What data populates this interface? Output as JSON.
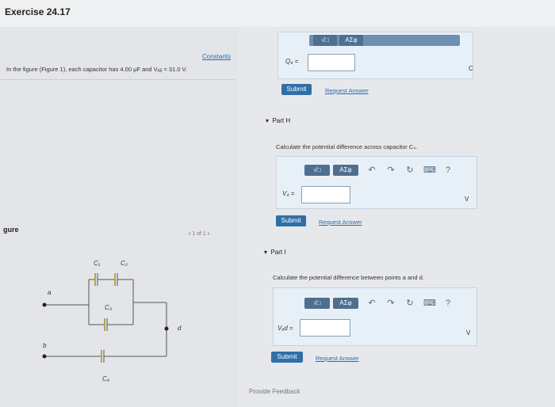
{
  "header": {
    "title": "Exercise 24.17"
  },
  "problem": {
    "constants_link": "Constants",
    "statement": "In the figure (Figure 1), each capacitor has 4.00 μF and Vₐᵦ = 31.0 V."
  },
  "figure": {
    "label": "gure",
    "pager": "1 of 1",
    "c1": "C₁",
    "c2": "C₂",
    "c3": "C₃",
    "c4": "C₄",
    "a": "a",
    "b": "b",
    "d": "d"
  },
  "part_g": {
    "field_label": "Q₄ =",
    "unit": "C",
    "submit": "Submit",
    "request": "Request Answer"
  },
  "part_h": {
    "title": "Part H",
    "question": "Calculate the potential difference across capacitor C₄.",
    "field_label": "V₄ =",
    "unit": "V",
    "submit": "Submit",
    "request": "Request Answer"
  },
  "part_i": {
    "title": "Part I",
    "question": "Calculate the potential difference between points a and d.",
    "field_label": "Vₐd =",
    "unit": "V",
    "submit": "Submit",
    "request": "Request Answer"
  },
  "toolbar": {
    "templates": "√□",
    "symbols": "AΣφ",
    "undo": "↶",
    "redo": "↷",
    "reset": "↻",
    "keyboard": "⌨",
    "help": "?"
  },
  "footer": {
    "feedback": "Provide Feedback"
  }
}
